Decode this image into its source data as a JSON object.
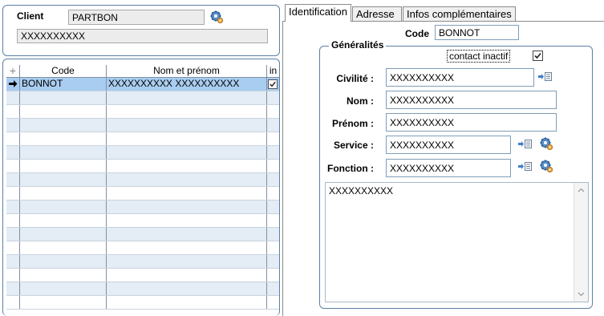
{
  "client": {
    "label": "Client",
    "code": "PARTBON",
    "name": "XXXXXXXXXX"
  },
  "list": {
    "headers": {
      "add": "+",
      "code": "Code",
      "name": "Nom et prénom",
      "inactive": "in"
    },
    "rows": [
      {
        "code": "BONNOT",
        "name": "XXXXXXXXXX XXXXXXXXXX",
        "inactive": true,
        "selected": true
      }
    ],
    "empty_rows": 16
  },
  "tabs": [
    {
      "label": "Identification",
      "active": true
    },
    {
      "label": "Adresse",
      "active": false
    },
    {
      "label": "Infos complémentaires",
      "active": false
    }
  ],
  "ident": {
    "code_label": "Code",
    "code_value": "BONNOT",
    "group_label": "Généralités",
    "inactive_label": "contact inactif",
    "inactive_checked": true,
    "civilite_label": "Civilité :",
    "civilite_value": "XXXXXXXXXX",
    "nom_label": "Nom :",
    "nom_value": "XXXXXXXXXX",
    "prenom_label": "Prénom :",
    "prenom_value": "XXXXXXXXXX",
    "service_label": "Service :",
    "service_value": "XXXXXXXXXX",
    "fonction_label": "Fonction :",
    "fonction_value": "XXXXXXXXXX",
    "notes_value": "XXXXXXXXXX"
  },
  "icons": {
    "gear": "gear-icon",
    "link": "link-list-icon",
    "arrow": "row-pointer-icon",
    "check": "checkbox-checked-icon"
  }
}
